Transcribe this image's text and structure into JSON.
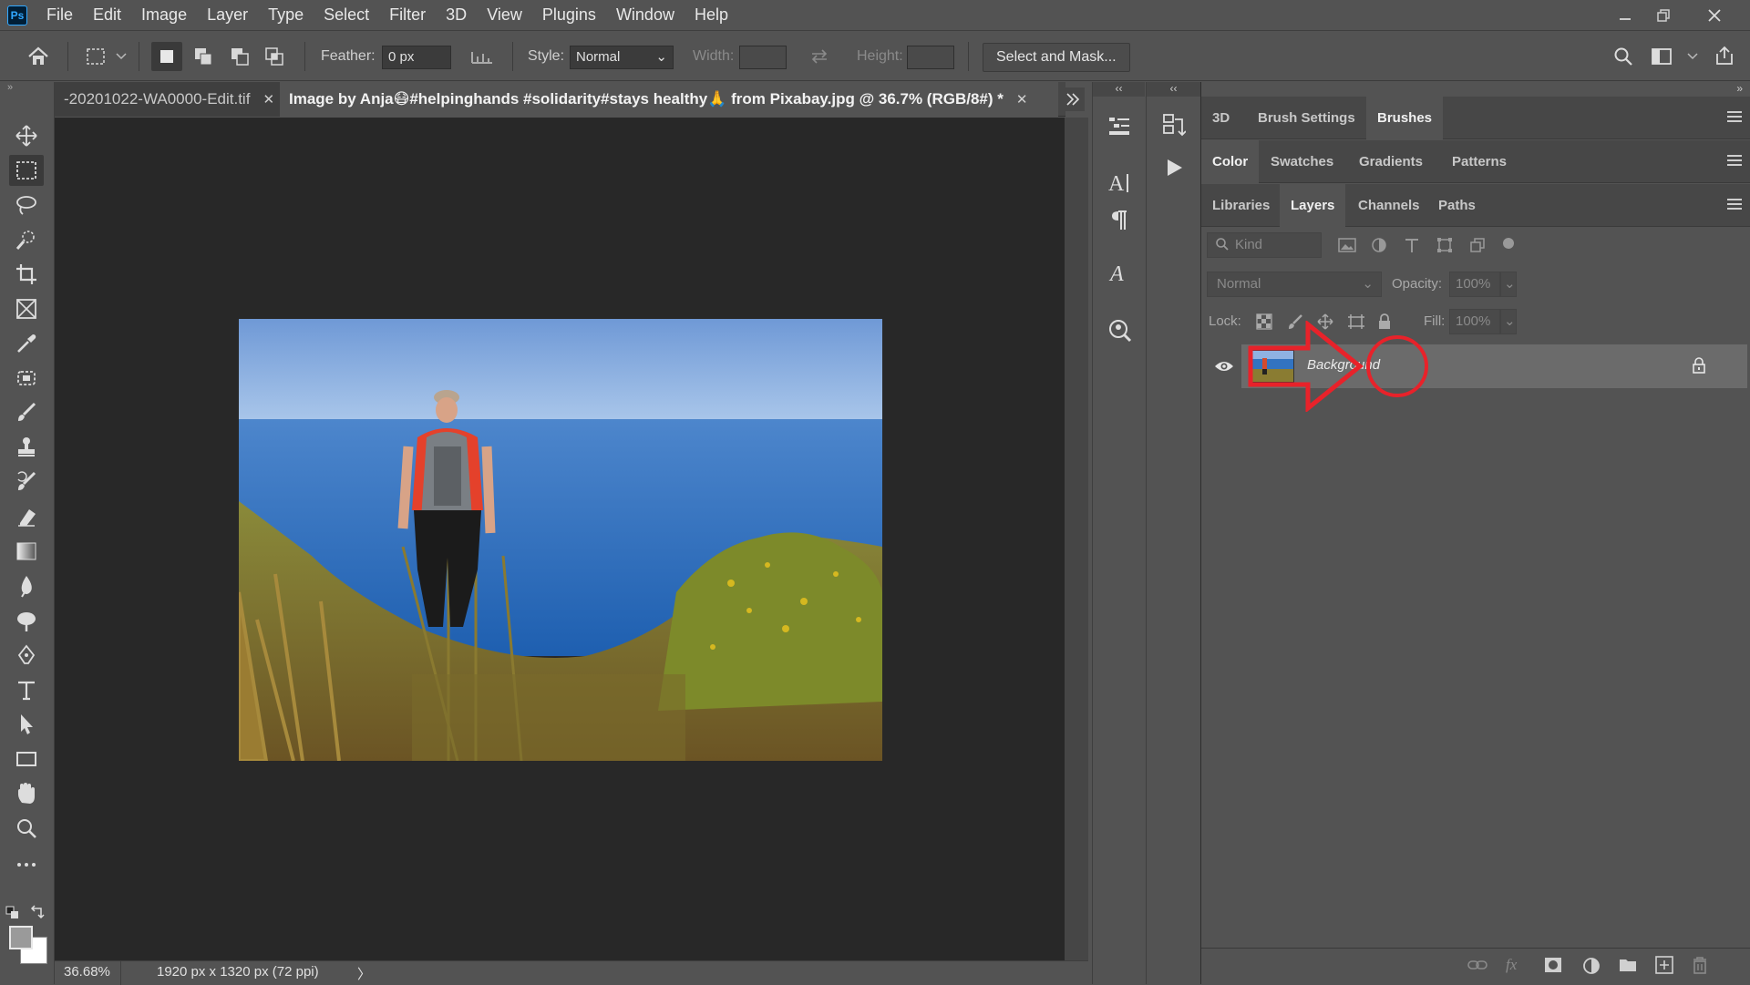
{
  "app": {
    "logo": "Ps"
  },
  "menu": [
    "File",
    "Edit",
    "Image",
    "Layer",
    "Type",
    "Select",
    "Filter",
    "3D",
    "View",
    "Plugins",
    "Window",
    "Help"
  ],
  "options": {
    "feather_label": "Feather:",
    "feather_value": "0 px",
    "style_label": "Style:",
    "style_value": "Normal",
    "width_label": "Width:",
    "height_label": "Height:",
    "select_mask": "Select and Mask..."
  },
  "tabs": [
    {
      "label": "-20201022-WA0000-Edit.tif",
      "active": false
    },
    {
      "label": "Image by Anja😷#helpinghands #solidarity#stays healthy🙏 from Pixabay.jpg @ 36.7% (RGB/8#) *",
      "active": true
    }
  ],
  "status": {
    "zoom": "36.68%",
    "doc_info": "1920 px x 1320 px (72 ppi)",
    "arrow": "〉"
  },
  "panels": {
    "group1": [
      "3D",
      "Brush Settings",
      "Brushes"
    ],
    "group1_active": 2,
    "group2": [
      "Color",
      "Swatches",
      "Gradients",
      "Patterns"
    ],
    "group2_active": 0,
    "group3": [
      "Libraries",
      "Layers",
      "Channels",
      "Paths"
    ],
    "group3_active": 1,
    "layers": {
      "filter_placeholder": "Kind",
      "blend_mode": "Normal",
      "opacity_label": "Opacity:",
      "opacity_value": "100%",
      "lock_label": "Lock:",
      "fill_label": "Fill:",
      "fill_value": "100%",
      "items": [
        {
          "name": "Background",
          "locked": true,
          "visible": true
        }
      ]
    }
  },
  "colors": {
    "accent": "#e8222a",
    "ps_blue": "#31a8ff"
  },
  "icons": {
    "annotation": "red-arrow-and-circle-highlighting-lock-icon"
  }
}
